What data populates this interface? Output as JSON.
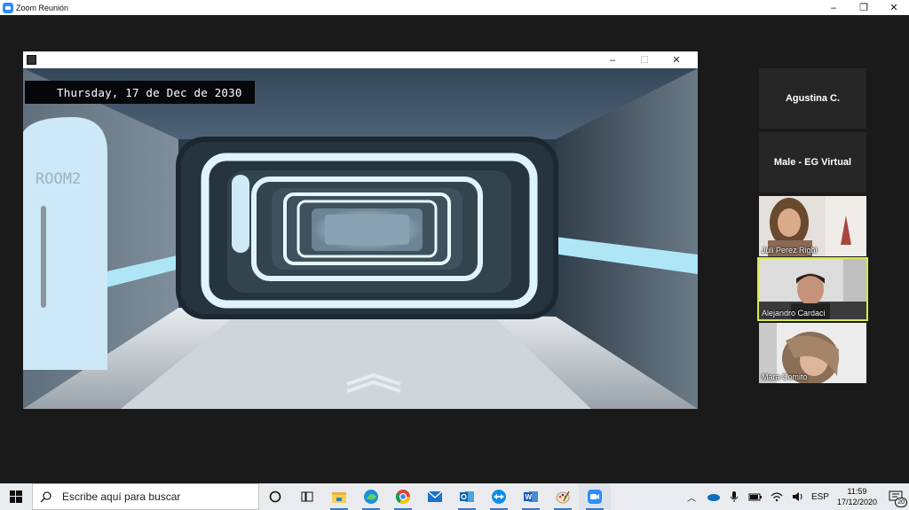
{
  "window": {
    "title": "Zoom Reunión",
    "controls": {
      "minimize": "–",
      "restore": "❐",
      "close": "✕"
    }
  },
  "shared_screen": {
    "controls": {
      "minimize": "–",
      "maximize": "☐",
      "close": "✕"
    },
    "date_text": "Thursday, 17 de Dec de 2030",
    "room_text": "ROOM2"
  },
  "participants": [
    {
      "name": "Agustina C.",
      "video": false
    },
    {
      "name": "Male - EG Virtual",
      "video": false
    },
    {
      "name": "Juli Perez Righi",
      "video": true
    },
    {
      "name": "Alejandro Cardaci",
      "video": true,
      "active_speaker": true
    },
    {
      "name": "Mara Comito",
      "video": true
    }
  ],
  "taskbar": {
    "search_placeholder": "Escribe aquí para buscar",
    "apps": [
      "cortana-icon",
      "task-view-icon",
      "file-explorer-icon",
      "edge-icon",
      "chrome-icon",
      "mail-icon",
      "outlook-icon",
      "teamviewer-icon",
      "word-icon",
      "paint-icon",
      "zoom-icon"
    ],
    "tray": {
      "language": "ESP",
      "time": "11:59",
      "date": "17/12/2020",
      "notifications": "20"
    }
  },
  "colors": {
    "zoom_blue": "#2d8cff",
    "active_border": "#d9e84a",
    "taskbar": "#e9ebee"
  }
}
